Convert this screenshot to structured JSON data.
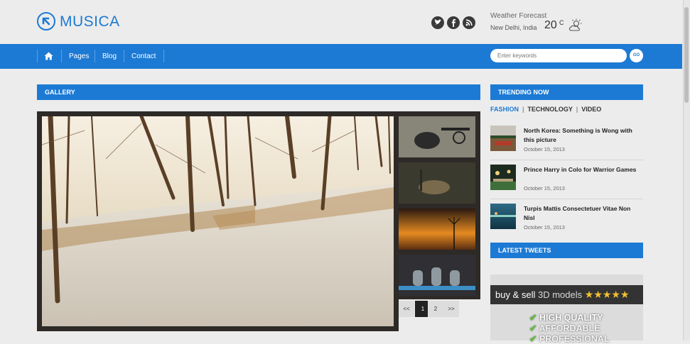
{
  "header": {
    "logo_text": "MUSICA",
    "social_icons": [
      "twitter-icon",
      "facebook-icon",
      "rss-icon"
    ],
    "weather": {
      "title": "Weather Forecast",
      "location": "New Delhi, India",
      "temperature": "20",
      "unit": "C",
      "icon": "cloud-sun-icon"
    }
  },
  "nav": {
    "home_icon": "home-icon",
    "items": [
      "Pages",
      "Blog",
      "Contact"
    ],
    "search_placeholder": "Enter keywords",
    "go_label": "GO"
  },
  "gallery": {
    "title": "GALLERY",
    "pager": [
      "<<",
      "1",
      "2",
      ">>"
    ],
    "active_page": "1"
  },
  "trending": {
    "title": "TRENDING NOW",
    "tabs": [
      "FASHION",
      "TECHNOLOGY",
      "VIDEO"
    ],
    "active_tab": "FASHION",
    "items": [
      {
        "title": "North Korea: Something is Wong with this picture",
        "date": "October 15, 2013"
      },
      {
        "title": "Prince Harry in Colo for Warrior Games",
        "date": "October 15, 2013"
      },
      {
        "title": "Turpis Mattis Consectetuer Vitae Non Nisl",
        "date": "October 15, 2013"
      }
    ]
  },
  "latest_tweets": {
    "title": "LATEST TWEETS"
  },
  "ad": {
    "headline_a": "buy & sell",
    "headline_b": "3D models",
    "stars": "★★★★★",
    "lines": [
      "HIGH QUALITY",
      "AFFORDABLE",
      "PROFESSIONAL"
    ]
  },
  "colors": {
    "brand_blue": "#1c7ad4",
    "background": "#ececec",
    "frame": "#2d2a27"
  }
}
